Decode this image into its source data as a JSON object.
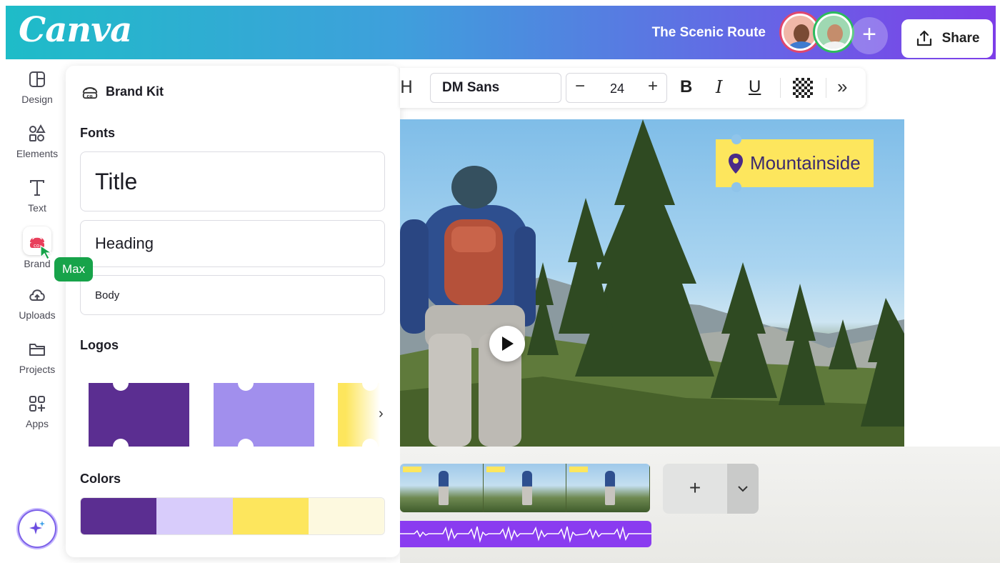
{
  "header": {
    "logo": "Canva",
    "doc_title": "The Scenic Route",
    "share_label": "Share"
  },
  "rail": {
    "items": [
      {
        "label": "Design",
        "icon": "layout-icon"
      },
      {
        "label": "Elements",
        "icon": "shapes-icon"
      },
      {
        "label": "Text",
        "icon": "text-icon"
      },
      {
        "label": "Brand",
        "icon": "brand-icon"
      },
      {
        "label": "Uploads",
        "icon": "cloud-upload-icon"
      },
      {
        "label": "Projects",
        "icon": "folder-icon"
      },
      {
        "label": "Apps",
        "icon": "apps-icon"
      }
    ]
  },
  "cursor_tooltip": "Max",
  "panel": {
    "title": "Brand Kit",
    "fonts_label": "Fonts",
    "fonts": [
      "Title",
      "Heading",
      "Body"
    ],
    "logos_label": "Logos",
    "logo_colors": [
      "#5b2e91",
      "#a18fed",
      "#fde65d"
    ],
    "colors_label": "Colors",
    "colors": [
      "#5b2e91",
      "#d8ccfb",
      "#fde65d",
      "#fdf9df"
    ]
  },
  "toolbar": {
    "font": "DM Sans",
    "size": "24",
    "bold": "B",
    "italic": "I",
    "underline": "U"
  },
  "canvas": {
    "tag_text": "Mountainside"
  },
  "colors": {
    "header_start": "#1ebcc8",
    "header_end": "#7d3ee8",
    "accent_yellow": "#fde65d",
    "audio_track": "#8a3cf0",
    "tooltip_green": "#17a34a"
  }
}
